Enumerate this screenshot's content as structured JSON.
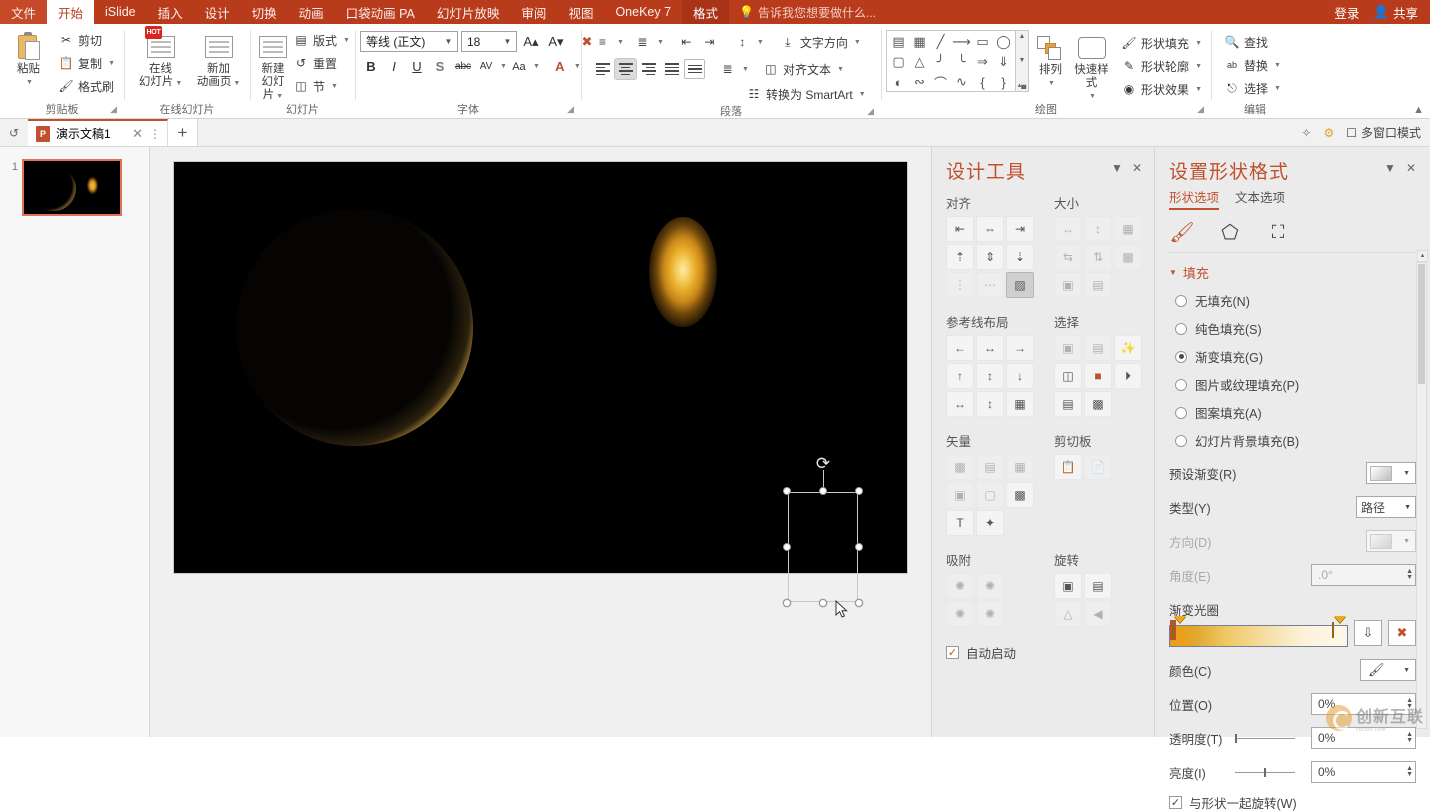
{
  "titlebar": {
    "tabs": [
      {
        "label": "文件",
        "state": "file"
      },
      {
        "label": "开始",
        "state": "active"
      },
      {
        "label": "iSlide",
        "state": "normal"
      },
      {
        "label": "插入",
        "state": "normal"
      },
      {
        "label": "设计",
        "state": "normal"
      },
      {
        "label": "切换",
        "state": "normal"
      },
      {
        "label": "动画",
        "state": "normal"
      },
      {
        "label": "口袋动画 PA",
        "state": "normal"
      },
      {
        "label": "幻灯片放映",
        "state": "normal"
      },
      {
        "label": "审阅",
        "state": "normal"
      },
      {
        "label": "视图",
        "state": "normal"
      },
      {
        "label": "OneKey 7",
        "state": "normal"
      },
      {
        "label": "格式",
        "state": "contextual"
      }
    ],
    "tellme_placeholder": "告诉我您想要做什么...",
    "signin": "登录",
    "share": "共享",
    "accent": "#b83b1c"
  },
  "ribbon": {
    "groups": [
      {
        "name": "剪贴板",
        "has_dialog_launcher": true,
        "big": [
          {
            "label1": "粘贴",
            "label2": "",
            "icon": "clipboard-icon",
            "dropdown": true
          }
        ],
        "small": [
          {
            "label": "剪切",
            "icon": "scissors-icon",
            "dropdown": false
          },
          {
            "label": "复制",
            "icon": "copy-icon",
            "dropdown": true
          },
          {
            "label": "格式刷",
            "icon": "format-painter-icon",
            "dropdown": false
          }
        ]
      },
      {
        "name": "在线幻灯片",
        "has_dialog_launcher": false,
        "big": [
          {
            "label1": "在线",
            "label2": "幻灯片",
            "icon": "online-slide-icon",
            "dropdown": true,
            "badge": "HOT"
          },
          {
            "label1": "新加",
            "label2": "动画页",
            "icon": "new-anim-page-icon",
            "dropdown": true
          }
        ],
        "small": []
      },
      {
        "name": "幻灯片",
        "has_dialog_launcher": false,
        "big": [
          {
            "label1": "新建",
            "label2": "幻灯片",
            "icon": "new-slide-icon",
            "dropdown": true
          }
        ],
        "small": [
          {
            "label": "版式",
            "icon": "layout-icon",
            "dropdown": true
          },
          {
            "label": "重置",
            "icon": "reset-icon",
            "dropdown": false
          },
          {
            "label": "节",
            "icon": "section-icon",
            "dropdown": true
          }
        ]
      },
      {
        "name": "字体",
        "has_dialog_launcher": true,
        "font_name": "等线 (正文)",
        "font_size": "18",
        "buttons_row1": [
          "grow-font-icon",
          "shrink-font-icon",
          "clear-format-icon"
        ],
        "buttons_row2": [
          {
            "label": "B",
            "name": "bold-button"
          },
          {
            "label": "I",
            "name": "italic-button"
          },
          {
            "label": "U",
            "name": "underline-button"
          },
          {
            "label": "S",
            "name": "shadow-button"
          },
          {
            "label": "abc",
            "name": "strikethrough-button"
          },
          {
            "label": "AV",
            "name": "character-spacing-button"
          },
          {
            "label": "Aa",
            "name": "change-case-button"
          },
          {
            "label": "A",
            "name": "font-color-button"
          }
        ]
      },
      {
        "name": "段落",
        "has_dialog_launcher": true,
        "text_buttons": [
          {
            "label": "文字方向",
            "icon": "text-direction-icon"
          },
          {
            "label": "对齐文本",
            "icon": "align-text-icon"
          },
          {
            "label": "转换为 SmartArt",
            "icon": "smartart-icon"
          }
        ]
      },
      {
        "name": "绘图",
        "has_dialog_launcher": true,
        "shape_glyphs": [
          "▣",
          "▥",
          "╲",
          "╲",
          "▭",
          "◯",
          "▢",
          "△",
          "⌐",
          "⌐",
          "⇨",
          "⇩",
          "◔",
          "⌇",
          "⌒",
          "∿",
          "{",
          "}"
        ],
        "big": [
          {
            "label1": "排列",
            "label2": "",
            "icon": "arrange-icon",
            "dropdown": true
          },
          {
            "label1": "快速样式",
            "label2": "",
            "icon": "quick-styles-icon",
            "dropdown": true
          }
        ],
        "small": [
          {
            "label": "形状填充",
            "icon": "shape-fill-icon",
            "dropdown": true
          },
          {
            "label": "形状轮廓",
            "icon": "shape-outline-icon",
            "dropdown": true
          },
          {
            "label": "形状效果",
            "icon": "shape-effects-icon",
            "dropdown": true
          }
        ]
      },
      {
        "name": "编辑",
        "has_dialog_launcher": false,
        "small": [
          {
            "label": "查找",
            "icon": "search-icon",
            "dropdown": false
          },
          {
            "label": "替换",
            "icon": "replace-icon",
            "dropdown": true
          },
          {
            "label": "选择",
            "icon": "select-icon",
            "dropdown": true
          }
        ]
      }
    ]
  },
  "docstrip": {
    "tab_label": "演示文稿1",
    "multiwindow_label": "多窗口模式"
  },
  "thumbnails": [
    {
      "number": "1",
      "selected": true
    }
  ],
  "slide": {
    "shapes": [
      {
        "name": "crescent-circle",
        "selected": false
      },
      {
        "name": "glow-ellipse",
        "selected": true
      }
    ]
  },
  "design_panel": {
    "title": "设计工具",
    "sections": [
      {
        "label": "对齐",
        "cells": 9,
        "selected_index": 8,
        "dim_after": -1
      },
      {
        "label": "大小",
        "cells": 8,
        "selected_index": -1,
        "dim": true
      },
      {
        "label": "参考线布局",
        "cells": 9,
        "selected_index": -1,
        "dim": false
      },
      {
        "label": "选择",
        "cells": 8,
        "selected_index": -1,
        "dim": false
      },
      {
        "label": "矢量",
        "cells": 8,
        "selected_index": -1,
        "dim": false
      },
      {
        "label": "剪切板",
        "cells": 2,
        "selected_index": -1,
        "dim": false
      },
      {
        "label": "吸附",
        "cells": 4,
        "selected_index": -1,
        "dim": true
      },
      {
        "label": "旋转",
        "cells": 4,
        "selected_index": -1,
        "dim": false
      }
    ],
    "autostart_label": "自动启动",
    "autostart_checked": true,
    "accent": "#c0502e"
  },
  "format_panel": {
    "title": "设置形状格式",
    "tabs": [
      {
        "label": "形状选项",
        "active": true
      },
      {
        "label": "文本选项",
        "active": false
      }
    ],
    "icon_tabs": [
      "fill-bucket-icon",
      "pentagon-effects-icon",
      "size-properties-icon"
    ],
    "fill_section": "填充",
    "fill_options": [
      {
        "label": "无填充(N)",
        "selected": false
      },
      {
        "label": "纯色填充(S)",
        "selected": false
      },
      {
        "label": "渐变填充(G)",
        "selected": true
      },
      {
        "label": "图片或纹理填充(P)",
        "selected": false
      },
      {
        "label": "图案填充(A)",
        "selected": false
      },
      {
        "label": "幻灯片背景填充(B)",
        "selected": false
      }
    ],
    "fields": [
      {
        "label": "预设渐变(R)",
        "type": "swatch",
        "value": "",
        "disabled": false
      },
      {
        "label": "类型(Y)",
        "type": "select",
        "value": "路径",
        "disabled": false
      },
      {
        "label": "方向(D)",
        "type": "swatch",
        "value": "",
        "disabled": true
      },
      {
        "label": "角度(E)",
        "type": "spin",
        "value": ".0°",
        "disabled": true
      }
    ],
    "gradient_stops_label": "渐变光圈",
    "gradient_stop_buttons": [
      "add-gradient-stop-icon",
      "remove-gradient-stop-icon"
    ],
    "stop_fields": [
      {
        "label": "颜色(C)",
        "type": "colorbtn",
        "value": ""
      },
      {
        "label": "位置(O)",
        "type": "spin",
        "value": "0%"
      },
      {
        "label": "透明度(T)",
        "type": "slider-spin",
        "value": "0%"
      },
      {
        "label": "亮度(I)",
        "type": "slider-spin",
        "value": "0%"
      }
    ],
    "rotate_with_shape_label": "与形状一起旋转(W)",
    "rotate_with_shape_checked": true,
    "accent": "#c0502e"
  },
  "watermark": {
    "text": "创新互联",
    "sub": "cdcxhl.com"
  }
}
